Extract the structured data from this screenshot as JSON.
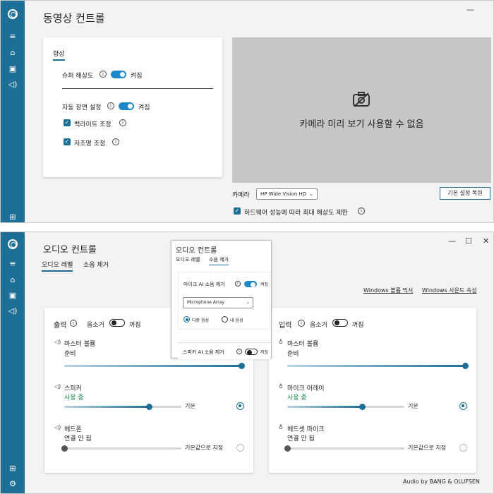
{
  "video_window": {
    "title": "동영상 컨트롤",
    "section_tab": "향상",
    "super_resolution_label": "슈퍼 해상도",
    "super_resolution_state": "켜짐",
    "auto_scene_label": "자동 장면 설정",
    "auto_scene_state": "켜짐",
    "backlight_label": "백라이트 조정",
    "lowlight_label": "저조명 조정",
    "preview_unavailable": "카메라 미리 보기 사용할 수 없음",
    "camera_label": "카메라",
    "camera_select": "HP Wide Vision HD",
    "restore_defaults": "기본 설정 복원",
    "limit_resolution_label": "하드웨어 성능에 따라 최대 해상도 제한"
  },
  "audio_window": {
    "title": "오디오 컨트롤",
    "tabs": [
      "오디오 레벨",
      "소음 제거"
    ],
    "links": [
      "Windows 볼륨 믹서",
      "Windows 사운드 속성"
    ],
    "output": {
      "heading": "출력",
      "mute_label": "음소거",
      "mute_state": "꺼짐",
      "master_label": "마스터 볼륨",
      "master_status": "준비",
      "master_level": 1.0,
      "device1_label": "스피커",
      "device1_status": "사용 중",
      "device1_level": 0.72,
      "device1_default": "기본",
      "device2_label": "헤드폰",
      "device2_status": "연결 안 됨",
      "device2_level": 0.0,
      "device2_default": "기본값으로 지정"
    },
    "input": {
      "heading": "입력",
      "mute_label": "음소거",
      "mute_state": "꺼짐",
      "master_label": "마스터 볼륨",
      "master_status": "준비",
      "master_level": 1.0,
      "device1_label": "마이크 어레이",
      "device1_status": "사용 중",
      "device1_level": 0.64,
      "device1_default": "기본",
      "device2_label": "헤드셋 마이크",
      "device2_status": "연결 안 됨",
      "device2_level": 0.0,
      "device2_default": "기본값으로 지정"
    },
    "footer_brand": "Audio by BANG & OLUFSEN"
  },
  "popup": {
    "title": "오디오 컨트롤",
    "tabs": [
      "오디오 레벨",
      "소음 제거"
    ],
    "mic_nc_label": "마이크 AI 소음 제거",
    "mic_nc_state": "켜짐",
    "mic_select": "Microphone Array",
    "radio1": "다중 음성",
    "radio2": "내 음성",
    "speaker_nc_label": "스피커 AI 소음 제거",
    "speaker_nc_state": "꺼짐"
  },
  "colors": {
    "accent": "#1e6f96",
    "toggle_on": "#1e88c8",
    "status_green": "#1a8a4a"
  }
}
